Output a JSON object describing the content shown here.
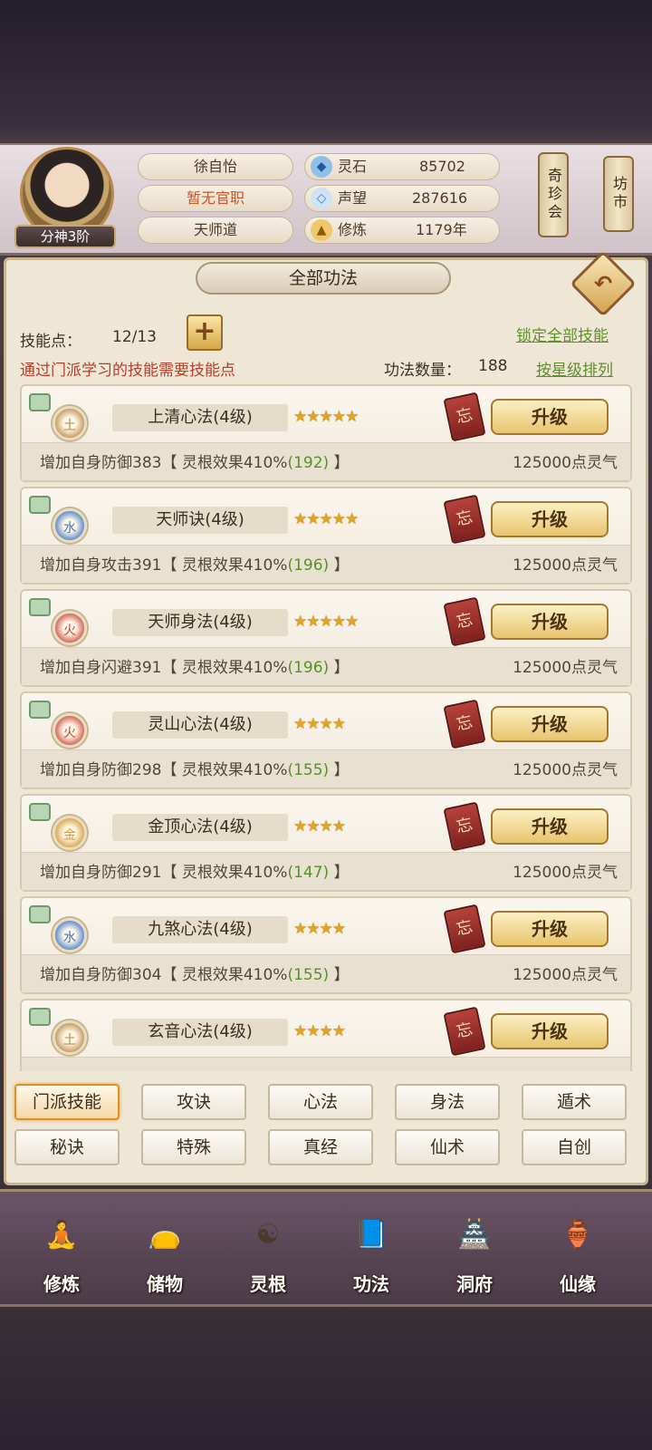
{
  "header": {
    "rank": "分神3阶",
    "name": "徐自怡",
    "office": "暂无官职",
    "sect": "天师道",
    "stats": [
      {
        "label": "灵石",
        "value": "85702",
        "icon": "spirit-stone-icon"
      },
      {
        "label": "声望",
        "value": "287616",
        "icon": "reputation-icon"
      },
      {
        "label": "修炼",
        "value": "1179年",
        "icon": "meditation-icon"
      }
    ],
    "shop1": "奇珍会",
    "shop2": "坊市"
  },
  "panel": {
    "title": "全部功法",
    "skill_points_label": "技能点：",
    "skill_points_value": "12/13",
    "note": "通过门派学习的技能需要技能点",
    "lock_all": "锁定全部技能",
    "count_label": "功法数量：",
    "count_value": "188",
    "sort_by_star": "按星级排列"
  },
  "skills": [
    {
      "name": "上清心法(4级)",
      "element": "土",
      "stars": 5,
      "effect": "增加自身防御383【 灵根效果410%",
      "bonus": "(192)",
      "effect_end": " 】",
      "cost": "125000点灵气",
      "forget": "忘",
      "upgrade": "升级"
    },
    {
      "name": "天师诀(4级)",
      "element": "水",
      "stars": 5,
      "effect": "增加自身攻击391【 灵根效果410%",
      "bonus": "(196)",
      "effect_end": " 】",
      "cost": "125000点灵气",
      "forget": "忘",
      "upgrade": "升级"
    },
    {
      "name": "天师身法(4级)",
      "element": "火",
      "stars": 5,
      "effect": "增加自身闪避391【 灵根效果410%",
      "bonus": "(196)",
      "effect_end": " 】",
      "cost": "125000点灵气",
      "forget": "忘",
      "upgrade": "升级"
    },
    {
      "name": "灵山心法(4级)",
      "element": "火",
      "stars": 4,
      "effect": "增加自身防御298【 灵根效果410%",
      "bonus": "(155)",
      "effect_end": " 】",
      "cost": "125000点灵气",
      "forget": "忘",
      "upgrade": "升级"
    },
    {
      "name": "金顶心法(4级)",
      "element": "金",
      "stars": 4,
      "effect": "增加自身防御291【 灵根效果410%",
      "bonus": "(147)",
      "effect_end": " 】",
      "cost": "125000点灵气",
      "forget": "忘",
      "upgrade": "升级"
    },
    {
      "name": "九煞心法(4级)",
      "element": "水",
      "stars": 4,
      "effect": "增加自身防御304【 灵根效果410%",
      "bonus": "(155)",
      "effect_end": " 】",
      "cost": "125000点灵气",
      "forget": "忘",
      "upgrade": "升级"
    },
    {
      "name": "玄音心法(4级)",
      "element": "土",
      "stars": 4,
      "effect": "",
      "bonus": "",
      "effect_end": "",
      "cost": "",
      "forget": "忘",
      "upgrade": "升级"
    }
  ],
  "element_colors": {
    "土": "#b98a4a",
    "水": "#3d79c9",
    "火": "#c94a3a",
    "金": "#d19a34"
  },
  "tabs": [
    "门派技能",
    "攻诀",
    "心法",
    "身法",
    "遁术",
    "秘诀",
    "特殊",
    "真经",
    "仙术",
    "自创"
  ],
  "active_tab": "门派技能",
  "nav": [
    {
      "label": "修炼",
      "icon": "cultivation-icon",
      "glyph": "🧘"
    },
    {
      "label": "储物",
      "icon": "storage-bag-icon",
      "glyph": "👝"
    },
    {
      "label": "灵根",
      "icon": "spirit-root-icon",
      "glyph": "☯"
    },
    {
      "label": "功法",
      "icon": "technique-book-icon",
      "glyph": "📘"
    },
    {
      "label": "洞府",
      "icon": "cave-dwelling-icon",
      "glyph": "🏯"
    },
    {
      "label": "仙缘",
      "icon": "immortal-fate-icon",
      "glyph": "🏺"
    }
  ]
}
